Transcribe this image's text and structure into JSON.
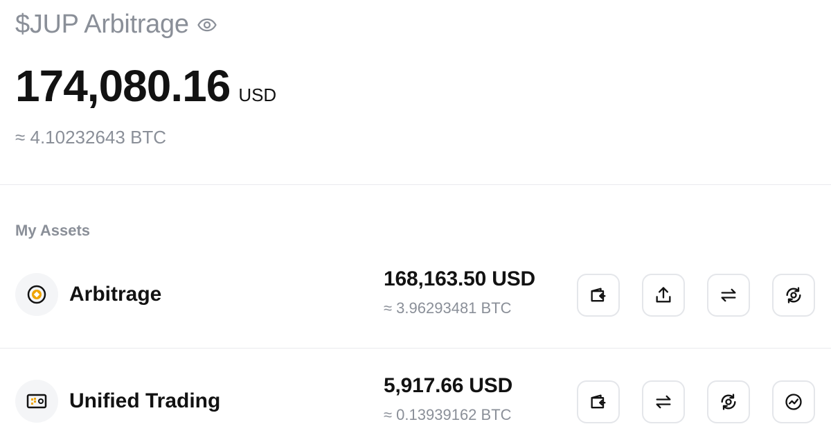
{
  "header": {
    "title": "$JUP Arbitrage",
    "eye_icon": "eye-icon",
    "balance": "174,080.16",
    "balance_unit": "USD",
    "balance_btc": "≈ 4.10232643 BTC"
  },
  "assets": {
    "section_label": "My Assets",
    "items": [
      {
        "name": "Arbitrage",
        "icon": "arbitrage-coin-icon",
        "usd": "168,163.50 USD",
        "btc": "≈ 3.96293481 BTC",
        "actions": [
          "wallet-deposit-icon",
          "upload-icon",
          "transfer-icon",
          "convert-icon"
        ]
      },
      {
        "name": "Unified Trading",
        "icon": "unified-trading-card-icon",
        "usd": "5,917.66 USD",
        "btc": "≈ 0.13939162 BTC",
        "actions": [
          "wallet-deposit-icon",
          "transfer-icon",
          "convert-icon",
          "chart-trend-icon"
        ]
      }
    ]
  },
  "colors": {
    "accent": "#f0a500",
    "muted_text": "#8a8f98",
    "primary_text": "#121212",
    "border": "#e4e6ea"
  }
}
